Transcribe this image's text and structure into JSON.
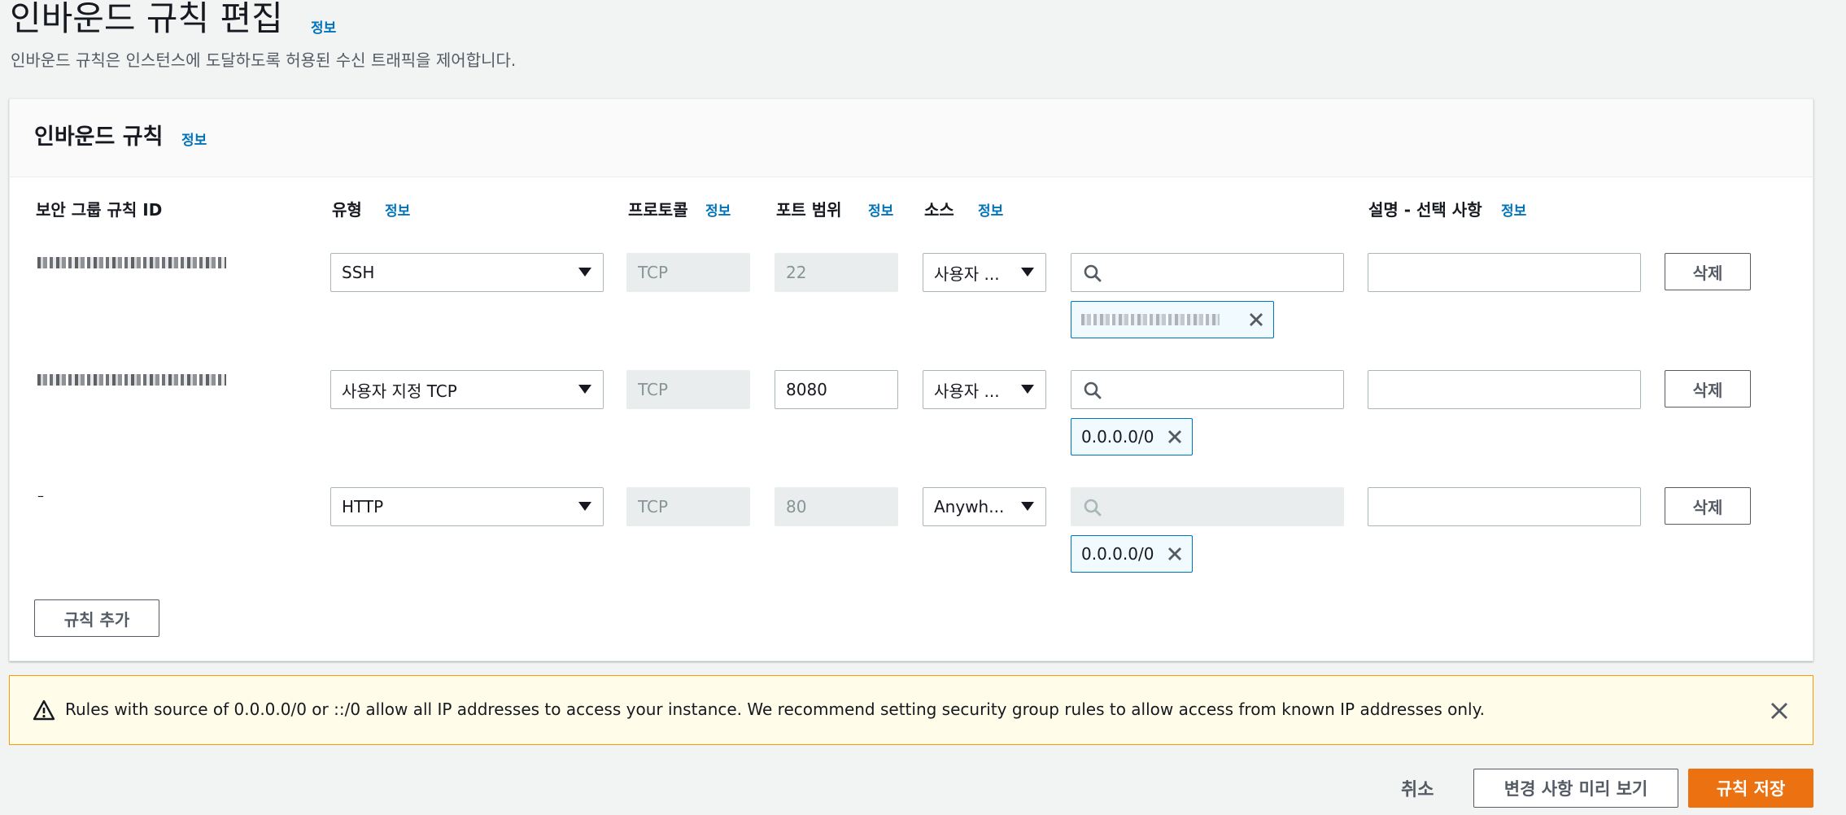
{
  "page": {
    "title": "인바운드 규칙 편집",
    "title_info": "정보",
    "description": "인바운드 규칙은 인스턴스에 도달하도록 허용된 수신 트래픽을 제어합니다."
  },
  "panel": {
    "title": "인바운드 규칙",
    "title_info": "정보",
    "columns": {
      "rule_id": "보안 그룹 규칙 ID",
      "type": "유형",
      "type_info": "정보",
      "protocol": "프로토콜",
      "protocol_info": "정보",
      "port_range": "포트 범위",
      "port_range_info": "정보",
      "source": "소스",
      "source_info": "정보",
      "description": "설명 - 선택 사항",
      "description_info": "정보"
    },
    "rules": [
      {
        "rule_id": "",
        "type": "SSH",
        "protocol": "TCP",
        "port": "22",
        "source_type": "사용자 ...",
        "source_token": "",
        "description": "",
        "delete_label": "삭제"
      },
      {
        "rule_id": "",
        "type": "사용자 지정 TCP",
        "protocol": "TCP",
        "port": "8080",
        "source_type": "사용자 ...",
        "source_token": "0.0.0.0/0",
        "description": "",
        "delete_label": "삭제"
      },
      {
        "rule_id": "–",
        "type": "HTTP",
        "protocol": "TCP",
        "port": "80",
        "source_type": "Anywh...",
        "source_token": "0.0.0.0/0",
        "description": "",
        "delete_label": "삭제"
      }
    ],
    "add_rule_label": "규칙 추가"
  },
  "alert": {
    "text": "Rules with source of 0.0.0.0/0 or ::/0 allow all IP addresses to access your instance. We recommend setting security group rules to allow access from known IP addresses only."
  },
  "footer": {
    "cancel_label": "취소",
    "preview_label": "변경 사항 미리 보기",
    "save_label": "규칙 저장"
  },
  "icons": {
    "search": "search-icon",
    "close": "close-icon",
    "caret": "caret-down-icon",
    "warning": "warning-icon"
  },
  "colors": {
    "link": "#0073bb",
    "primary_button": "#ec7211",
    "alert_border": "#ff9900",
    "alert_bg": "#fffce9",
    "token_border": "#0073bb"
  }
}
